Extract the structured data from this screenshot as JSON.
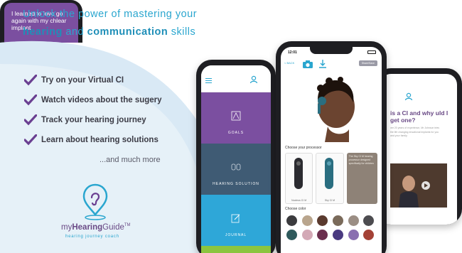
{
  "headline": {
    "line1": "Unlock the power of mastering your",
    "line2_bold1": "hearing",
    "line2_mid": " and ",
    "line2_bold2": "communication",
    "line2_end": " skills"
  },
  "features": [
    "Try on your Virtual CI",
    "Watch videos about the sugery",
    "Track your hearing journey",
    "Learn about hearing solutions"
  ],
  "more_text": "...and much more",
  "logo": {
    "name_light": "my",
    "name_bold": "Hearing",
    "name_end": "Guide",
    "tm": "TM",
    "tagline": "hearing journey coach"
  },
  "phone_left": {
    "tiles": [
      "GOALS",
      "HEARING SOLUTION",
      "JOURNAL"
    ]
  },
  "phone_mid": {
    "time": "12:01",
    "back": "< BACK",
    "share": "Share/Save",
    "section_processor": "Choose your processor",
    "processors": [
      "Nucleus CI M",
      "Sky CI M"
    ],
    "processor_info": "The Sky CI M hearing processor designed specifically for children",
    "section_color": "Choose color",
    "swatches": [
      "#3b3b3e",
      "#b9a58d",
      "#5a3a2e",
      "#7a6a5a",
      "#9b8e84",
      "#4d4c50",
      "#2f5a5c",
      "#d3a9b6",
      "#6b2f4e",
      "#4a3a80",
      "#8a6fb0",
      "#a44236"
    ]
  },
  "phone_right": {
    "question": "is a CI and why uld I get one?",
    "body": "ver 20 years of experience, Mr Johnson tries the life changing ensational implants for you and your family.",
    "card": "I learned to love go again with my chlear implant"
  },
  "colors": {
    "accent_blue": "#2aa6cf",
    "purple": "#7b4fa0",
    "check_purple": "#6a3f91",
    "slate": "#3f5b74",
    "green": "#8bc53f"
  }
}
